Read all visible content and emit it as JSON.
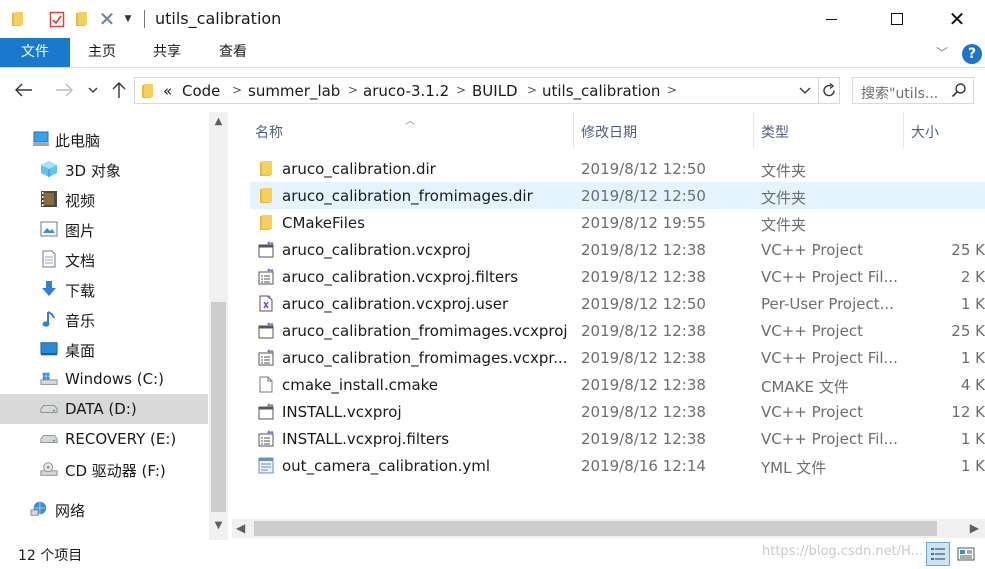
{
  "window": {
    "title": "utils_calibration",
    "accent": "#1979ca"
  },
  "ribbon": {
    "tabs": [
      {
        "label": "文件"
      },
      {
        "label": "主页"
      },
      {
        "label": "共享"
      },
      {
        "label": "查看"
      }
    ],
    "help": "?"
  },
  "address": {
    "overflow": "«",
    "crumbs": [
      "Code",
      "summer_lab",
      "aruco-3.1.2",
      "BUILD",
      "utils_calibration"
    ],
    "search_placeholder": "搜索\"utils..."
  },
  "navpane": {
    "items": [
      {
        "label": "此电脑",
        "icon": "this-pc-icon"
      },
      {
        "label": "3D 对象",
        "icon": "3d-objects-icon"
      },
      {
        "label": "视频",
        "icon": "videos-icon"
      },
      {
        "label": "图片",
        "icon": "pictures-icon"
      },
      {
        "label": "文档",
        "icon": "documents-icon"
      },
      {
        "label": "下载",
        "icon": "downloads-icon"
      },
      {
        "label": "音乐",
        "icon": "music-icon"
      },
      {
        "label": "桌面",
        "icon": "desktop-icon"
      },
      {
        "label": "Windows (C:)",
        "icon": "windows-drive-icon"
      },
      {
        "label": "DATA (D:)",
        "icon": "drive-icon",
        "selected": true
      },
      {
        "label": "RECOVERY (E:)",
        "icon": "drive-icon"
      },
      {
        "label": "CD 驱动器 (F:)",
        "icon": "cd-drive-icon"
      },
      {
        "label": "网络",
        "icon": "network-icon"
      }
    ]
  },
  "columns": {
    "name": "名称",
    "date": "修改日期",
    "type": "类型",
    "size": "大小"
  },
  "files": [
    {
      "name": "aruco_calibration.dir",
      "date": "2019/8/12 12:50",
      "type": "文件夹",
      "size": "",
      "icon": "folder-icon"
    },
    {
      "name": "aruco_calibration_fromimages.dir",
      "date": "2019/8/12 12:50",
      "type": "文件夹",
      "size": "",
      "icon": "folder-icon",
      "hover": true
    },
    {
      "name": "CMakeFiles",
      "date": "2019/8/12 19:55",
      "type": "文件夹",
      "size": "",
      "icon": "folder-icon"
    },
    {
      "name": "aruco_calibration.vcxproj",
      "date": "2019/8/12 12:38",
      "type": "VC++ Project",
      "size": "25 K",
      "icon": "vcxproj-icon"
    },
    {
      "name": "aruco_calibration.vcxproj.filters",
      "date": "2019/8/12 12:38",
      "type": "VC++ Project Fil...",
      "size": "2 K",
      "icon": "vcxproj-filters-icon"
    },
    {
      "name": "aruco_calibration.vcxproj.user",
      "date": "2019/8/12 12:50",
      "type": "Per-User Project...",
      "size": "1 K",
      "icon": "vcxproj-user-icon"
    },
    {
      "name": "aruco_calibration_fromimages.vcxproj",
      "date": "2019/8/12 12:38",
      "type": "VC++ Project",
      "size": "25 K",
      "icon": "vcxproj-icon"
    },
    {
      "name": "aruco_calibration_fromimages.vcxpr...",
      "date": "2019/8/12 12:38",
      "type": "VC++ Project Fil...",
      "size": "1 K",
      "icon": "vcxproj-filters-icon"
    },
    {
      "name": "cmake_install.cmake",
      "date": "2019/8/12 12:38",
      "type": "CMAKE 文件",
      "size": "4 K",
      "icon": "cmake-file-icon"
    },
    {
      "name": "INSTALL.vcxproj",
      "date": "2019/8/12 12:38",
      "type": "VC++ Project",
      "size": "12 K",
      "icon": "vcxproj-icon"
    },
    {
      "name": "INSTALL.vcxproj.filters",
      "date": "2019/8/12 12:38",
      "type": "VC++ Project Fil...",
      "size": "1 K",
      "icon": "vcxproj-filters-icon"
    },
    {
      "name": "out_camera_calibration.yml",
      "date": "2019/8/16 12:14",
      "type": "YML 文件",
      "size": "1 K",
      "icon": "yml-file-icon"
    }
  ],
  "status": {
    "count": "12 个项目",
    "watermark": "https://blog.csdn.net/H..."
  }
}
